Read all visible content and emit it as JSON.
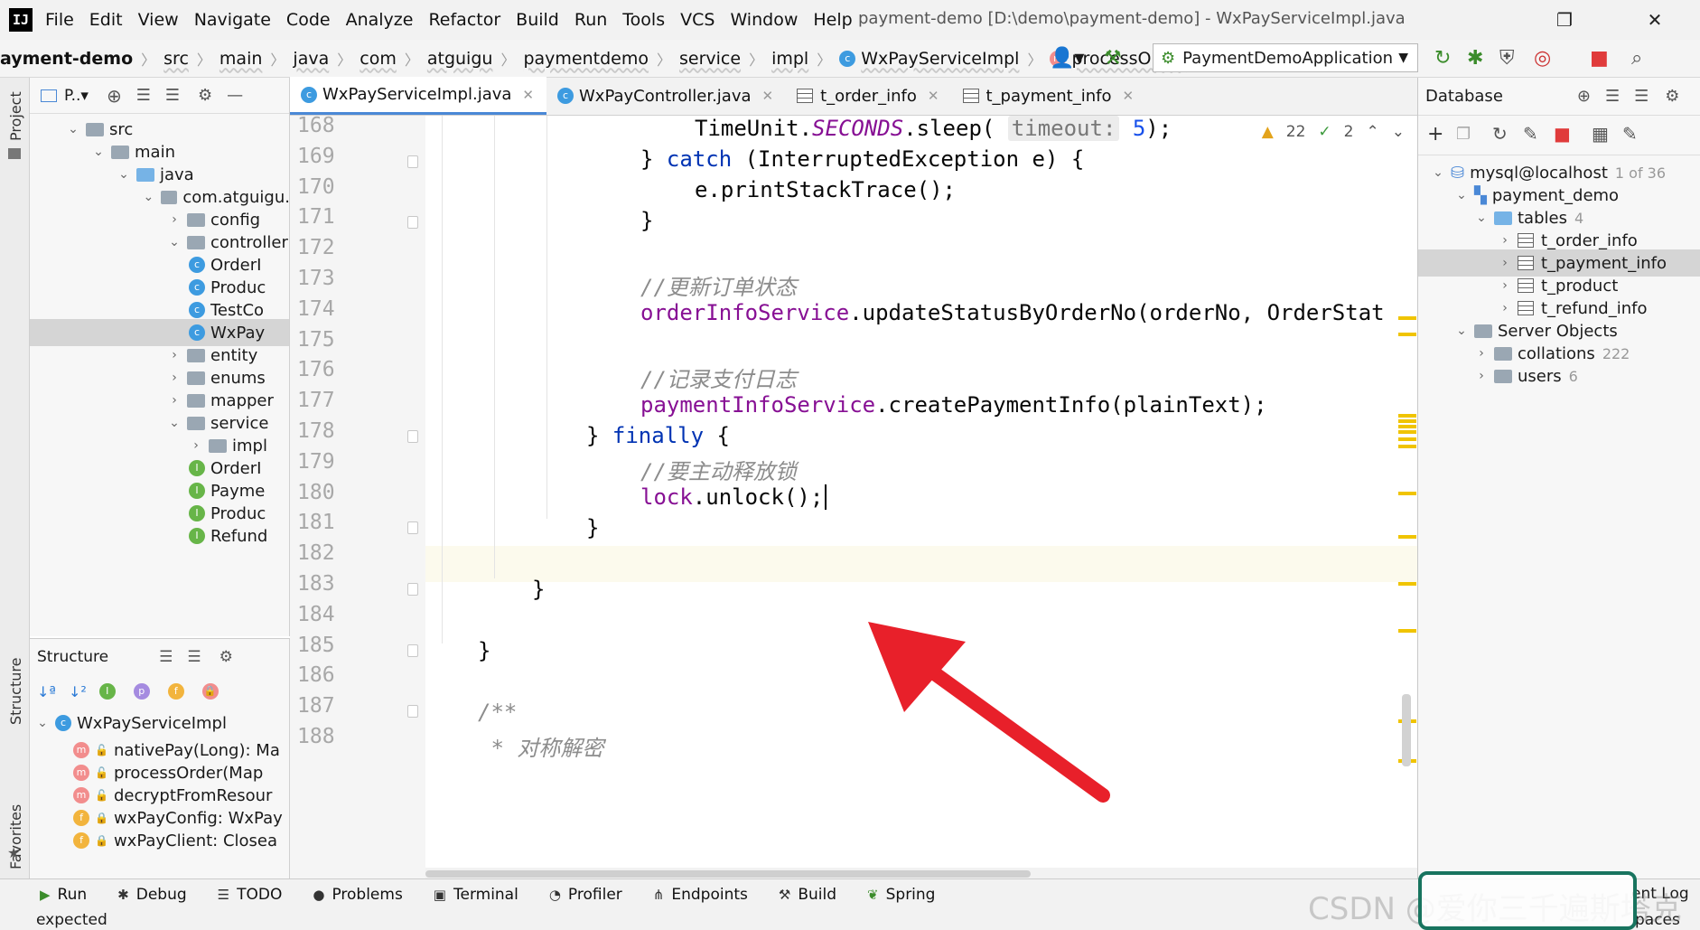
{
  "menubar": {
    "logo": "IJ",
    "items": [
      "File",
      "Edit",
      "View",
      "Navigate",
      "Code",
      "Analyze",
      "Refactor",
      "Build",
      "Run",
      "Tools",
      "VCS",
      "Window",
      "Help"
    ],
    "window_title": "payment-demo [D:\\demo\\payment-demo] - WxPayServiceImpl.java"
  },
  "breadcrumbs": {
    "project": "ayment-demo",
    "items": [
      "src",
      "main",
      "java",
      "com",
      "atguigu",
      "paymentdemo",
      "service",
      "impl"
    ],
    "class": "WxPayServiceImpl",
    "method": "processOrder",
    "run_config": "PaymentDemoApplication"
  },
  "left_stripe": {
    "project": "Project",
    "structure": "Structure",
    "favorites": "Favorites"
  },
  "project_panel": {
    "title": "P..▾",
    "tree": [
      {
        "label": "src",
        "kind": "folder"
      },
      {
        "label": "main",
        "kind": "folder"
      },
      {
        "label": "java",
        "kind": "folder-blue"
      },
      {
        "label": "com.atguigu.",
        "kind": "folder"
      },
      {
        "label": "config",
        "kind": "folder"
      },
      {
        "label": "controller",
        "kind": "folder"
      },
      {
        "label": "OrderI",
        "kind": "class"
      },
      {
        "label": "Produc",
        "kind": "class"
      },
      {
        "label": "TestCo",
        "kind": "class"
      },
      {
        "label": "WxPay",
        "kind": "class",
        "selected": true
      },
      {
        "label": "entity",
        "kind": "folder"
      },
      {
        "label": "enums",
        "kind": "folder"
      },
      {
        "label": "mapper",
        "kind": "folder"
      },
      {
        "label": "service",
        "kind": "folder"
      },
      {
        "label": "impl",
        "kind": "folder"
      },
      {
        "label": "OrderI",
        "kind": "interface"
      },
      {
        "label": "Payme",
        "kind": "interface"
      },
      {
        "label": "Produc",
        "kind": "interface"
      },
      {
        "label": "Refund",
        "kind": "interface"
      }
    ]
  },
  "structure_panel": {
    "title": "Structure",
    "class": "WxPayServiceImpl",
    "members": [
      {
        "label": "nativePay(Long): Ma",
        "kind": "method"
      },
      {
        "label": "processOrder(Map",
        "kind": "method"
      },
      {
        "label": "decryptFromResour",
        "kind": "method"
      },
      {
        "label": "wxPayConfig: WxPay",
        "kind": "field"
      },
      {
        "label": "wxPayClient: Closea",
        "kind": "field"
      }
    ]
  },
  "editor_tabs": [
    {
      "label": "WxPayServiceImpl.java",
      "active": true
    },
    {
      "label": "WxPayController.java",
      "active": false
    },
    {
      "label": "t_order_info",
      "active": false
    },
    {
      "label": "t_payment_info",
      "active": false
    }
  ],
  "inspections": {
    "warnings": "22",
    "weak": "2"
  },
  "code": {
    "line_numbers": [
      "168",
      "169",
      "170",
      "171",
      "172",
      "173",
      "174",
      "175",
      "176",
      "177",
      "178",
      "179",
      "180",
      "181",
      "182",
      "183",
      "184",
      "185",
      "186",
      "187",
      "188"
    ],
    "l168_a": "TimeUnit.",
    "l168_b": "SECONDS",
    "l168_c": ".sleep( ",
    "l168_hint": "timeout:",
    "l168_num": "5",
    "l168_d": ");",
    "l169_a": "} ",
    "l169_kw": "catch",
    "l169_b": " (InterruptedException e) {",
    "l170": "e.printStackTrace();",
    "l171": "}",
    "l173": "//更新订单状态",
    "l174_fld": "orderInfoService",
    "l174_b": ".updateStatusByOrderNo(orderNo, OrderStat",
    "l176": "//记录支付日志",
    "l177_fld": "paymentInfoService",
    "l177_b": ".createPaymentInfo(plainText);",
    "l178_a": "} ",
    "l178_kw": "finally",
    "l178_b": " {",
    "l179": "//要主动释放锁",
    "l180_fld": "lock",
    "l180_b": ".unlock();",
    "l181": "}",
    "l183": "}",
    "l185": "}",
    "l187": "/**",
    "l188": " * 对称解密"
  },
  "db_panel": {
    "title": "Database",
    "tree": [
      {
        "label": "mysql@localhost",
        "count": "1 of 36"
      },
      {
        "label": "payment_demo",
        "count": ""
      },
      {
        "label": "tables",
        "count": "4"
      },
      {
        "label": "t_order_info",
        "count": ""
      },
      {
        "label": "t_payment_info",
        "count": "",
        "selected": true
      },
      {
        "label": "t_product",
        "count": ""
      },
      {
        "label": "t_refund_info",
        "count": ""
      },
      {
        "label": "Server Objects",
        "count": ""
      },
      {
        "label": "collations",
        "count": "222"
      },
      {
        "label": "users",
        "count": "6"
      }
    ]
  },
  "bottom_tools": [
    "Run",
    "Debug",
    "TODO",
    "Problems",
    "Terminal",
    "Profiler",
    "Endpoints",
    "Build",
    "Spring"
  ],
  "bottom_right": "ent Log",
  "bottom_right_2": "paces",
  "status": "expected",
  "watermark": "CSDN @爱你三千遍斯塔克",
  "colors": {
    "arrow": "#e8202a",
    "accent": "#4a88d6"
  }
}
